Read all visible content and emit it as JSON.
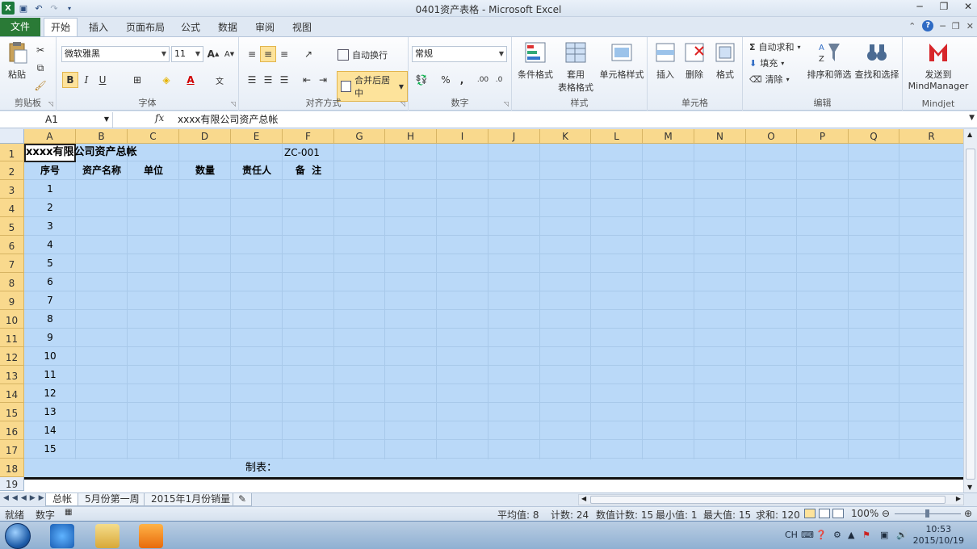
{
  "window": {
    "title": "0401资产表格 - Microsoft Excel"
  },
  "ribbon": {
    "file_tab": "文件",
    "tabs": [
      "开始",
      "插入",
      "页面布局",
      "公式",
      "数据",
      "审阅",
      "视图"
    ],
    "clipboard": {
      "paste": "粘贴",
      "group": "剪贴板"
    },
    "font": {
      "name": "微软雅黑",
      "size": "11",
      "group": "字体",
      "bold": "B",
      "italic": "I",
      "underline": "U"
    },
    "alignment": {
      "wrap": "自动换行",
      "merge": "合并后居中",
      "group": "对齐方式"
    },
    "number": {
      "format": "常规",
      "percent": "%",
      "comma": ",",
      "group": "数字"
    },
    "styles": {
      "conditional": "条件格式",
      "table1": "套用",
      "table2": "表格格式",
      "cell_styles": "单元格样式",
      "group": "样式"
    },
    "cells": {
      "insert": "插入",
      "delete": "删除",
      "format": "格式",
      "group": "单元格"
    },
    "editing": {
      "autosum": "自动求和",
      "fill": "填充",
      "clear": "清除",
      "sort": "排序和筛选",
      "find": "查找和选择",
      "group": "编辑"
    },
    "mindjet": {
      "send1": "发送到",
      "send2": "MindManager",
      "group": "Mindjet"
    }
  },
  "formula_bar": {
    "name_box": "A1",
    "fx": "fx",
    "content": "xxxx有限公司资产总帐"
  },
  "columns": [
    "A",
    "B",
    "C",
    "D",
    "E",
    "F",
    "G",
    "H",
    "I",
    "J",
    "K",
    "L",
    "M",
    "N",
    "O",
    "P",
    "Q",
    "R"
  ],
  "rows": [
    "1",
    "2",
    "3",
    "4",
    "5",
    "6",
    "7",
    "8",
    "9",
    "10",
    "11",
    "12",
    "13",
    "14",
    "15",
    "16",
    "17",
    "18",
    "19"
  ],
  "sheet": {
    "title": "xxxx有限公司资产总帐",
    "code": "ZC-001",
    "headers": [
      "序号",
      "资产名称",
      "单位",
      "数量",
      "责任人",
      "备  注"
    ],
    "numbers": [
      "1",
      "2",
      "3",
      "4",
      "5",
      "6",
      "7",
      "8",
      "9",
      "10",
      "11",
      "12",
      "13",
      "14",
      "15"
    ],
    "maker": "制表："
  },
  "sheet_tabs": [
    "总帐",
    "5月份第一周",
    "2015年1月份销量"
  ],
  "status": {
    "ready": "就绪",
    "num": "数字",
    "average": "平均值: 8",
    "count": "计数: 24",
    "numcount": "数值计数: 15",
    "min": "最小值: 1",
    "max": "最大值: 15",
    "sum": "求和: 120",
    "zoom": "100%"
  },
  "taskbar": {
    "lang": "CH",
    "time": "10:53",
    "date": "2015/10/19"
  },
  "colors": {
    "selection": "#bad9f8",
    "header_selected": "#f9d98d",
    "file_tab": "#2a7a36",
    "status_accent": "#fde39b"
  }
}
